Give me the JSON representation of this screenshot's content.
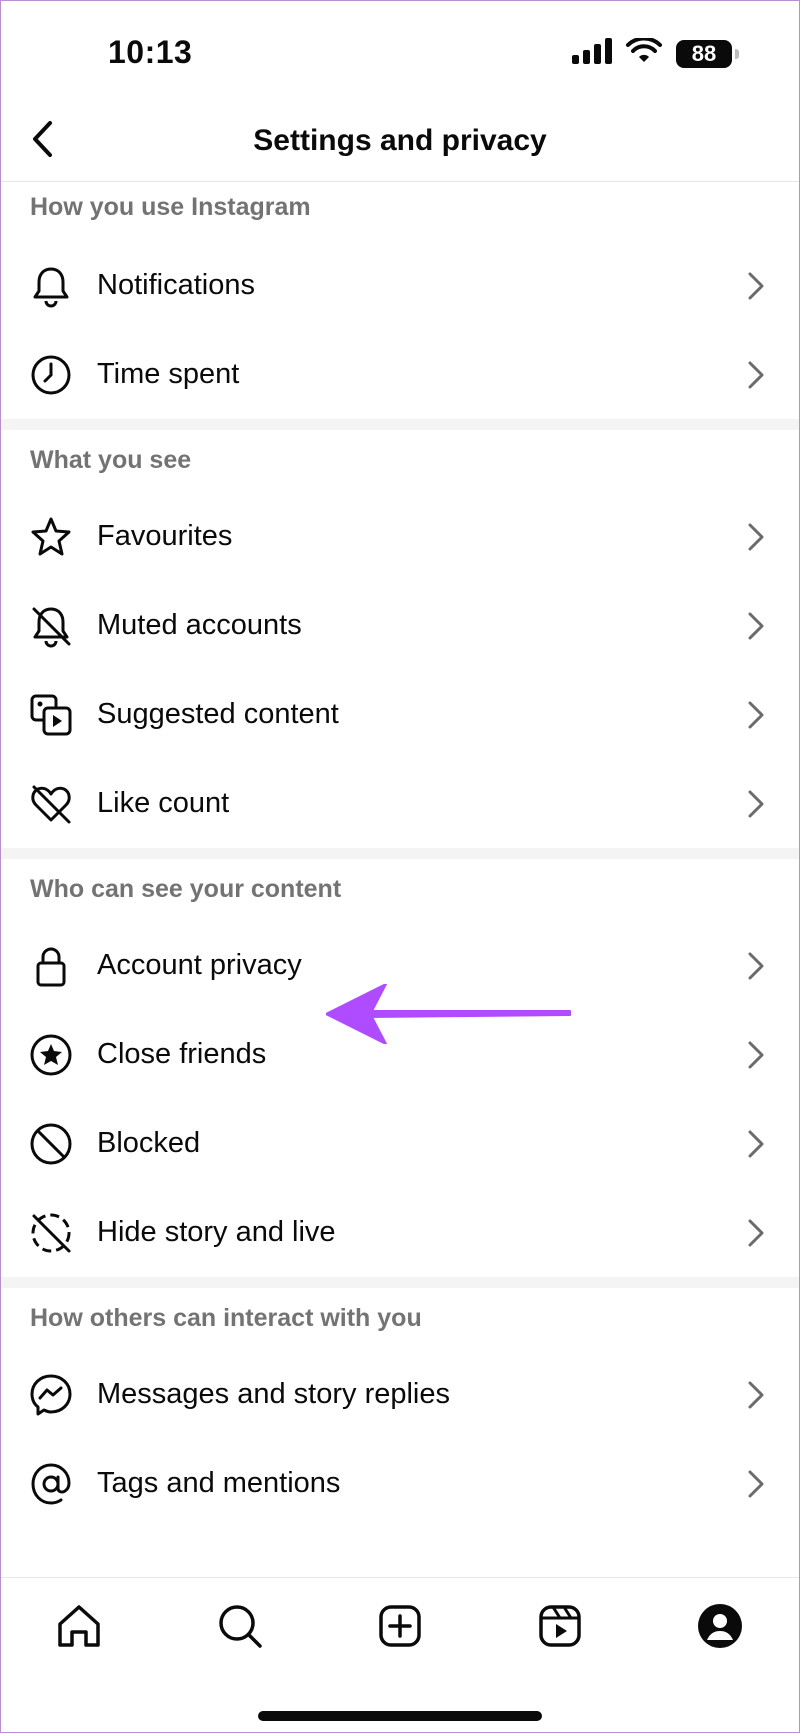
{
  "status": {
    "time": "10:13",
    "battery": "88"
  },
  "header": {
    "title": "Settings and privacy",
    "back_icon": "chevron-left-icon"
  },
  "sections": [
    {
      "title": "How you use Instagram",
      "items": [
        {
          "label": "Notifications",
          "icon": "bell-icon"
        },
        {
          "label": "Time spent",
          "icon": "clock-icon"
        }
      ]
    },
    {
      "title": "What you see",
      "items": [
        {
          "label": "Favourites",
          "icon": "star-icon"
        },
        {
          "label": "Muted accounts",
          "icon": "muted-bell-icon"
        },
        {
          "label": "Suggested content",
          "icon": "suggested-content-icon"
        },
        {
          "label": "Like count",
          "icon": "heart-off-icon"
        }
      ]
    },
    {
      "title": "Who can see your content",
      "items": [
        {
          "label": "Account privacy",
          "icon": "lock-icon"
        },
        {
          "label": "Close friends",
          "icon": "star-circle-icon"
        },
        {
          "label": "Blocked",
          "icon": "blocked-icon"
        },
        {
          "label": "Hide story and live",
          "icon": "story-off-icon"
        }
      ]
    },
    {
      "title": "How others can interact with you",
      "items": [
        {
          "label": "Messages and story replies",
          "icon": "messenger-icon"
        },
        {
          "label": "Tags and mentions",
          "icon": "at-sign-icon"
        }
      ]
    }
  ],
  "annotation": {
    "color": "#b04cff",
    "target": "Account privacy"
  },
  "tabbar": [
    "home-icon",
    "search-icon",
    "create-icon",
    "reels-icon",
    "profile-icon"
  ]
}
